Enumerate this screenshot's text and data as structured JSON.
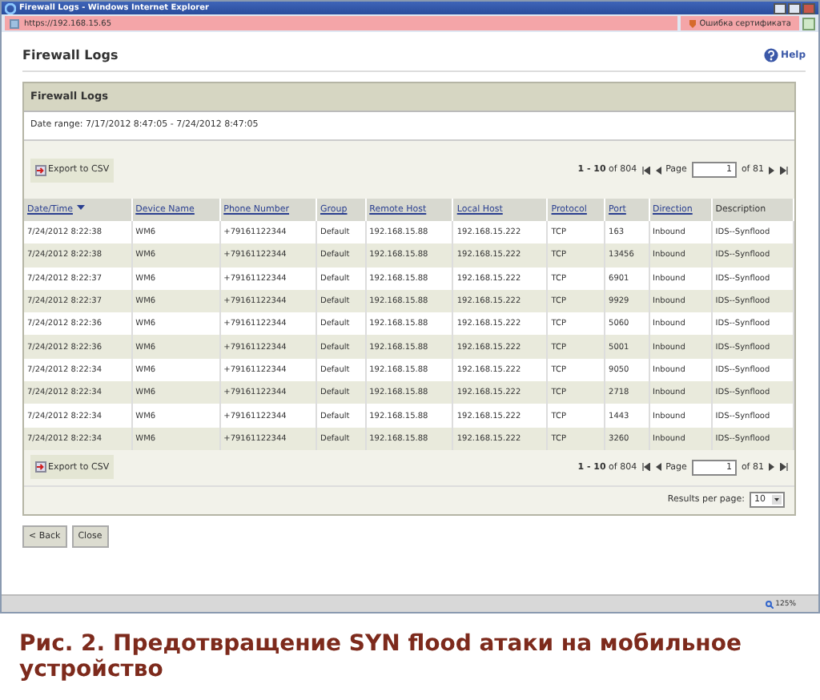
{
  "window": {
    "title": "Firewall Logs - Windows Internet Explorer",
    "address": "https://192.168.15.65",
    "cert_error": "Ошибка сертификата",
    "zoom": "125%"
  },
  "page": {
    "title": "Firewall Logs",
    "help": "Help"
  },
  "panel": {
    "title": "Firewall Logs",
    "date_range": "Date range: 7/17/2012 8:47:05 - 7/24/2012 8:47:05"
  },
  "toolbars": [
    {
      "export_label": "Export to CSV",
      "pagination": {
        "range": "1 - 10",
        "total": "of 804",
        "page_label": "Page",
        "page": "1",
        "pages": "of 81"
      }
    },
    {
      "export_label": "Export to CSV",
      "pagination": {
        "range": "1 - 10",
        "total": "of 804",
        "page_label": "Page",
        "page": "1",
        "pages": "of 81"
      }
    }
  ],
  "table": {
    "columns": [
      {
        "label": "Date/Time",
        "sortable": true,
        "sorted": true
      },
      {
        "label": "Device Name",
        "sortable": true,
        "sorted": false
      },
      {
        "label": "Phone Number",
        "sortable": true,
        "sorted": false
      },
      {
        "label": "Group",
        "sortable": true,
        "sorted": false
      },
      {
        "label": "Remote Host",
        "sortable": true,
        "sorted": false
      },
      {
        "label": "Local Host",
        "sortable": true,
        "sorted": false
      },
      {
        "label": "Protocol",
        "sortable": true,
        "sorted": false
      },
      {
        "label": "Port",
        "sortable": true,
        "sorted": false
      },
      {
        "label": "Direction",
        "sortable": true,
        "sorted": false
      },
      {
        "label": "Description",
        "sortable": false,
        "sorted": false
      }
    ],
    "rows": [
      [
        "7/24/2012 8:22:38",
        "WM6",
        "+79161122344",
        "Default",
        "192.168.15.88",
        "192.168.15.222",
        "TCP",
        "163",
        "Inbound",
        "IDS--Synflood"
      ],
      [
        "7/24/2012 8:22:38",
        "WM6",
        "+79161122344",
        "Default",
        "192.168.15.88",
        "192.168.15.222",
        "TCP",
        "13456",
        "Inbound",
        "IDS--Synflood"
      ],
      [
        "7/24/2012 8:22:37",
        "WM6",
        "+79161122344",
        "Default",
        "192.168.15.88",
        "192.168.15.222",
        "TCP",
        "6901",
        "Inbound",
        "IDS--Synflood"
      ],
      [
        "7/24/2012 8:22:37",
        "WM6",
        "+79161122344",
        "Default",
        "192.168.15.88",
        "192.168.15.222",
        "TCP",
        "9929",
        "Inbound",
        "IDS--Synflood"
      ],
      [
        "7/24/2012 8:22:36",
        "WM6",
        "+79161122344",
        "Default",
        "192.168.15.88",
        "192.168.15.222",
        "TCP",
        "5060",
        "Inbound",
        "IDS--Synflood"
      ],
      [
        "7/24/2012 8:22:36",
        "WM6",
        "+79161122344",
        "Default",
        "192.168.15.88",
        "192.168.15.222",
        "TCP",
        "5001",
        "Inbound",
        "IDS--Synflood"
      ],
      [
        "7/24/2012 8:22:34",
        "WM6",
        "+79161122344",
        "Default",
        "192.168.15.88",
        "192.168.15.222",
        "TCP",
        "9050",
        "Inbound",
        "IDS--Synflood"
      ],
      [
        "7/24/2012 8:22:34",
        "WM6",
        "+79161122344",
        "Default",
        "192.168.15.88",
        "192.168.15.222",
        "TCP",
        "2718",
        "Inbound",
        "IDS--Synflood"
      ],
      [
        "7/24/2012 8:22:34",
        "WM6",
        "+79161122344",
        "Default",
        "192.168.15.88",
        "192.168.15.222",
        "TCP",
        "1443",
        "Inbound",
        "IDS--Synflood"
      ],
      [
        "7/24/2012 8:22:34",
        "WM6",
        "+79161122344",
        "Default",
        "192.168.15.88",
        "192.168.15.222",
        "TCP",
        "3260",
        "Inbound",
        "IDS--Synflood"
      ]
    ]
  },
  "results_per_page": {
    "label": "Results per page:",
    "value": "10"
  },
  "buttons": [
    "< Back",
    "Close"
  ],
  "caption": "Рис. 2. Предотвращение SYN flood атаки на мобильное устройство"
}
